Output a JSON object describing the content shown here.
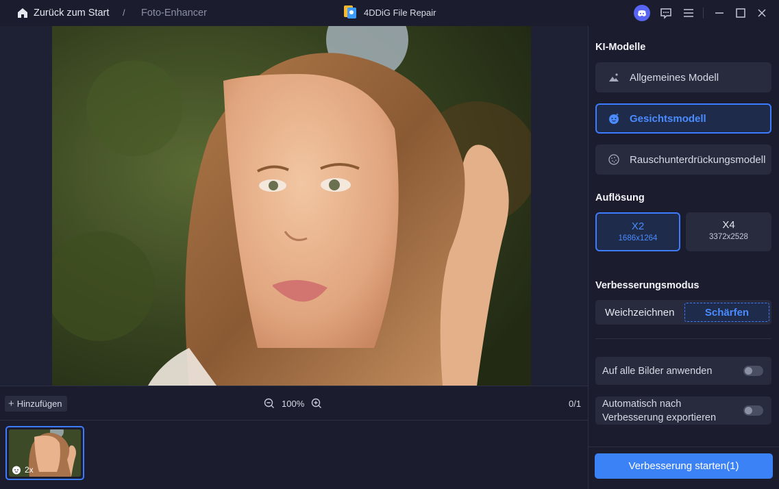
{
  "titlebar": {
    "back_label": "Zurück zum Start",
    "separator": "/",
    "breadcrumb": "Foto-Enhancer",
    "app_name": "4DDiG File Repair"
  },
  "canvas": {
    "image": "portrait-photo"
  },
  "bottombar": {
    "add_label": "Hinzufügen",
    "zoom": "100%",
    "counter": "0/1"
  },
  "thumbnail": {
    "scale_label": "2x"
  },
  "panel": {
    "models_heading": "KI-Modelle",
    "models": [
      {
        "label": "Allgemeines Modell",
        "icon": "landscape-icon",
        "active": false
      },
      {
        "label": "Gesichtsmodell",
        "icon": "face-icon",
        "active": true
      },
      {
        "label": "Rauschunterdrückungsmodell",
        "icon": "noise-icon",
        "active": false
      }
    ],
    "resolution_heading": "Auflösung",
    "resolutions": [
      {
        "label": "X2",
        "size": "1686x1264",
        "active": true
      },
      {
        "label": "X4",
        "size": "3372x2528",
        "active": false
      }
    ],
    "mode_heading": "Verbesserungsmodus",
    "modes": {
      "soft": "Weichzeichnen",
      "sharp": "Schärfen",
      "selected": "Schärfen"
    },
    "options": {
      "apply_all": "Auf alle Bilder anwenden",
      "auto_export_line1": "Automatisch nach",
      "auto_export_line2": "Verbesserung exportieren"
    },
    "start_button": "Verbesserung starten(1)"
  },
  "colors": {
    "accent": "#3d7bff",
    "background": "#1b1d2e",
    "card": "#282b3e"
  }
}
